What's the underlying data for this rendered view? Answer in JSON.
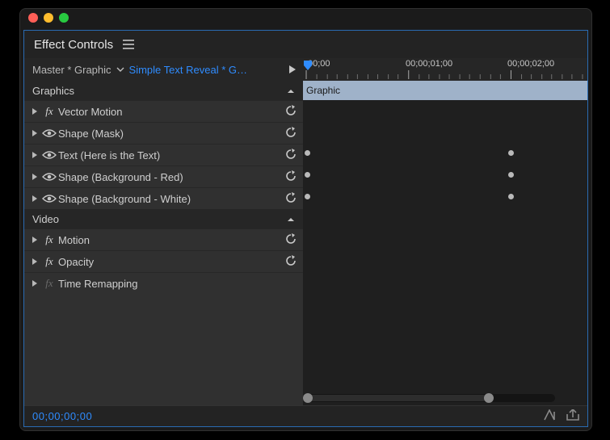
{
  "panel": {
    "title": "Effect Controls"
  },
  "crumb": {
    "master": "Master * Graphic",
    "clip": "Simple Text Reveal * G…"
  },
  "ruler": {
    "labels": [
      "00;00",
      "00;00;01;00",
      "00;00;02;00"
    ]
  },
  "clip_band": {
    "label": "Graphic"
  },
  "sections": {
    "graphics": {
      "title": "Graphics",
      "rows": [
        {
          "icon": "fx",
          "label": "Vector Motion",
          "reset": true
        },
        {
          "icon": "eye",
          "label": "Shape (Mask)",
          "reset": true
        },
        {
          "icon": "eye",
          "label": "Text (Here is the Text)",
          "reset": true,
          "kf_left": true,
          "kf_right": true
        },
        {
          "icon": "eye",
          "label": "Shape (Background - Red)",
          "reset": true,
          "kf_left": true,
          "kf_right": true
        },
        {
          "icon": "eye",
          "label": "Shape (Background - White)",
          "reset": true,
          "kf_left": true,
          "kf_right": true
        }
      ]
    },
    "video": {
      "title": "Video",
      "rows": [
        {
          "icon": "fx",
          "label": "Motion",
          "reset": true
        },
        {
          "icon": "fx",
          "label": "Opacity",
          "reset": true
        },
        {
          "icon": "fx-dim",
          "label": "Time Remapping",
          "reset": false
        }
      ]
    }
  },
  "footer": {
    "timecode": "00;00;00;00"
  }
}
